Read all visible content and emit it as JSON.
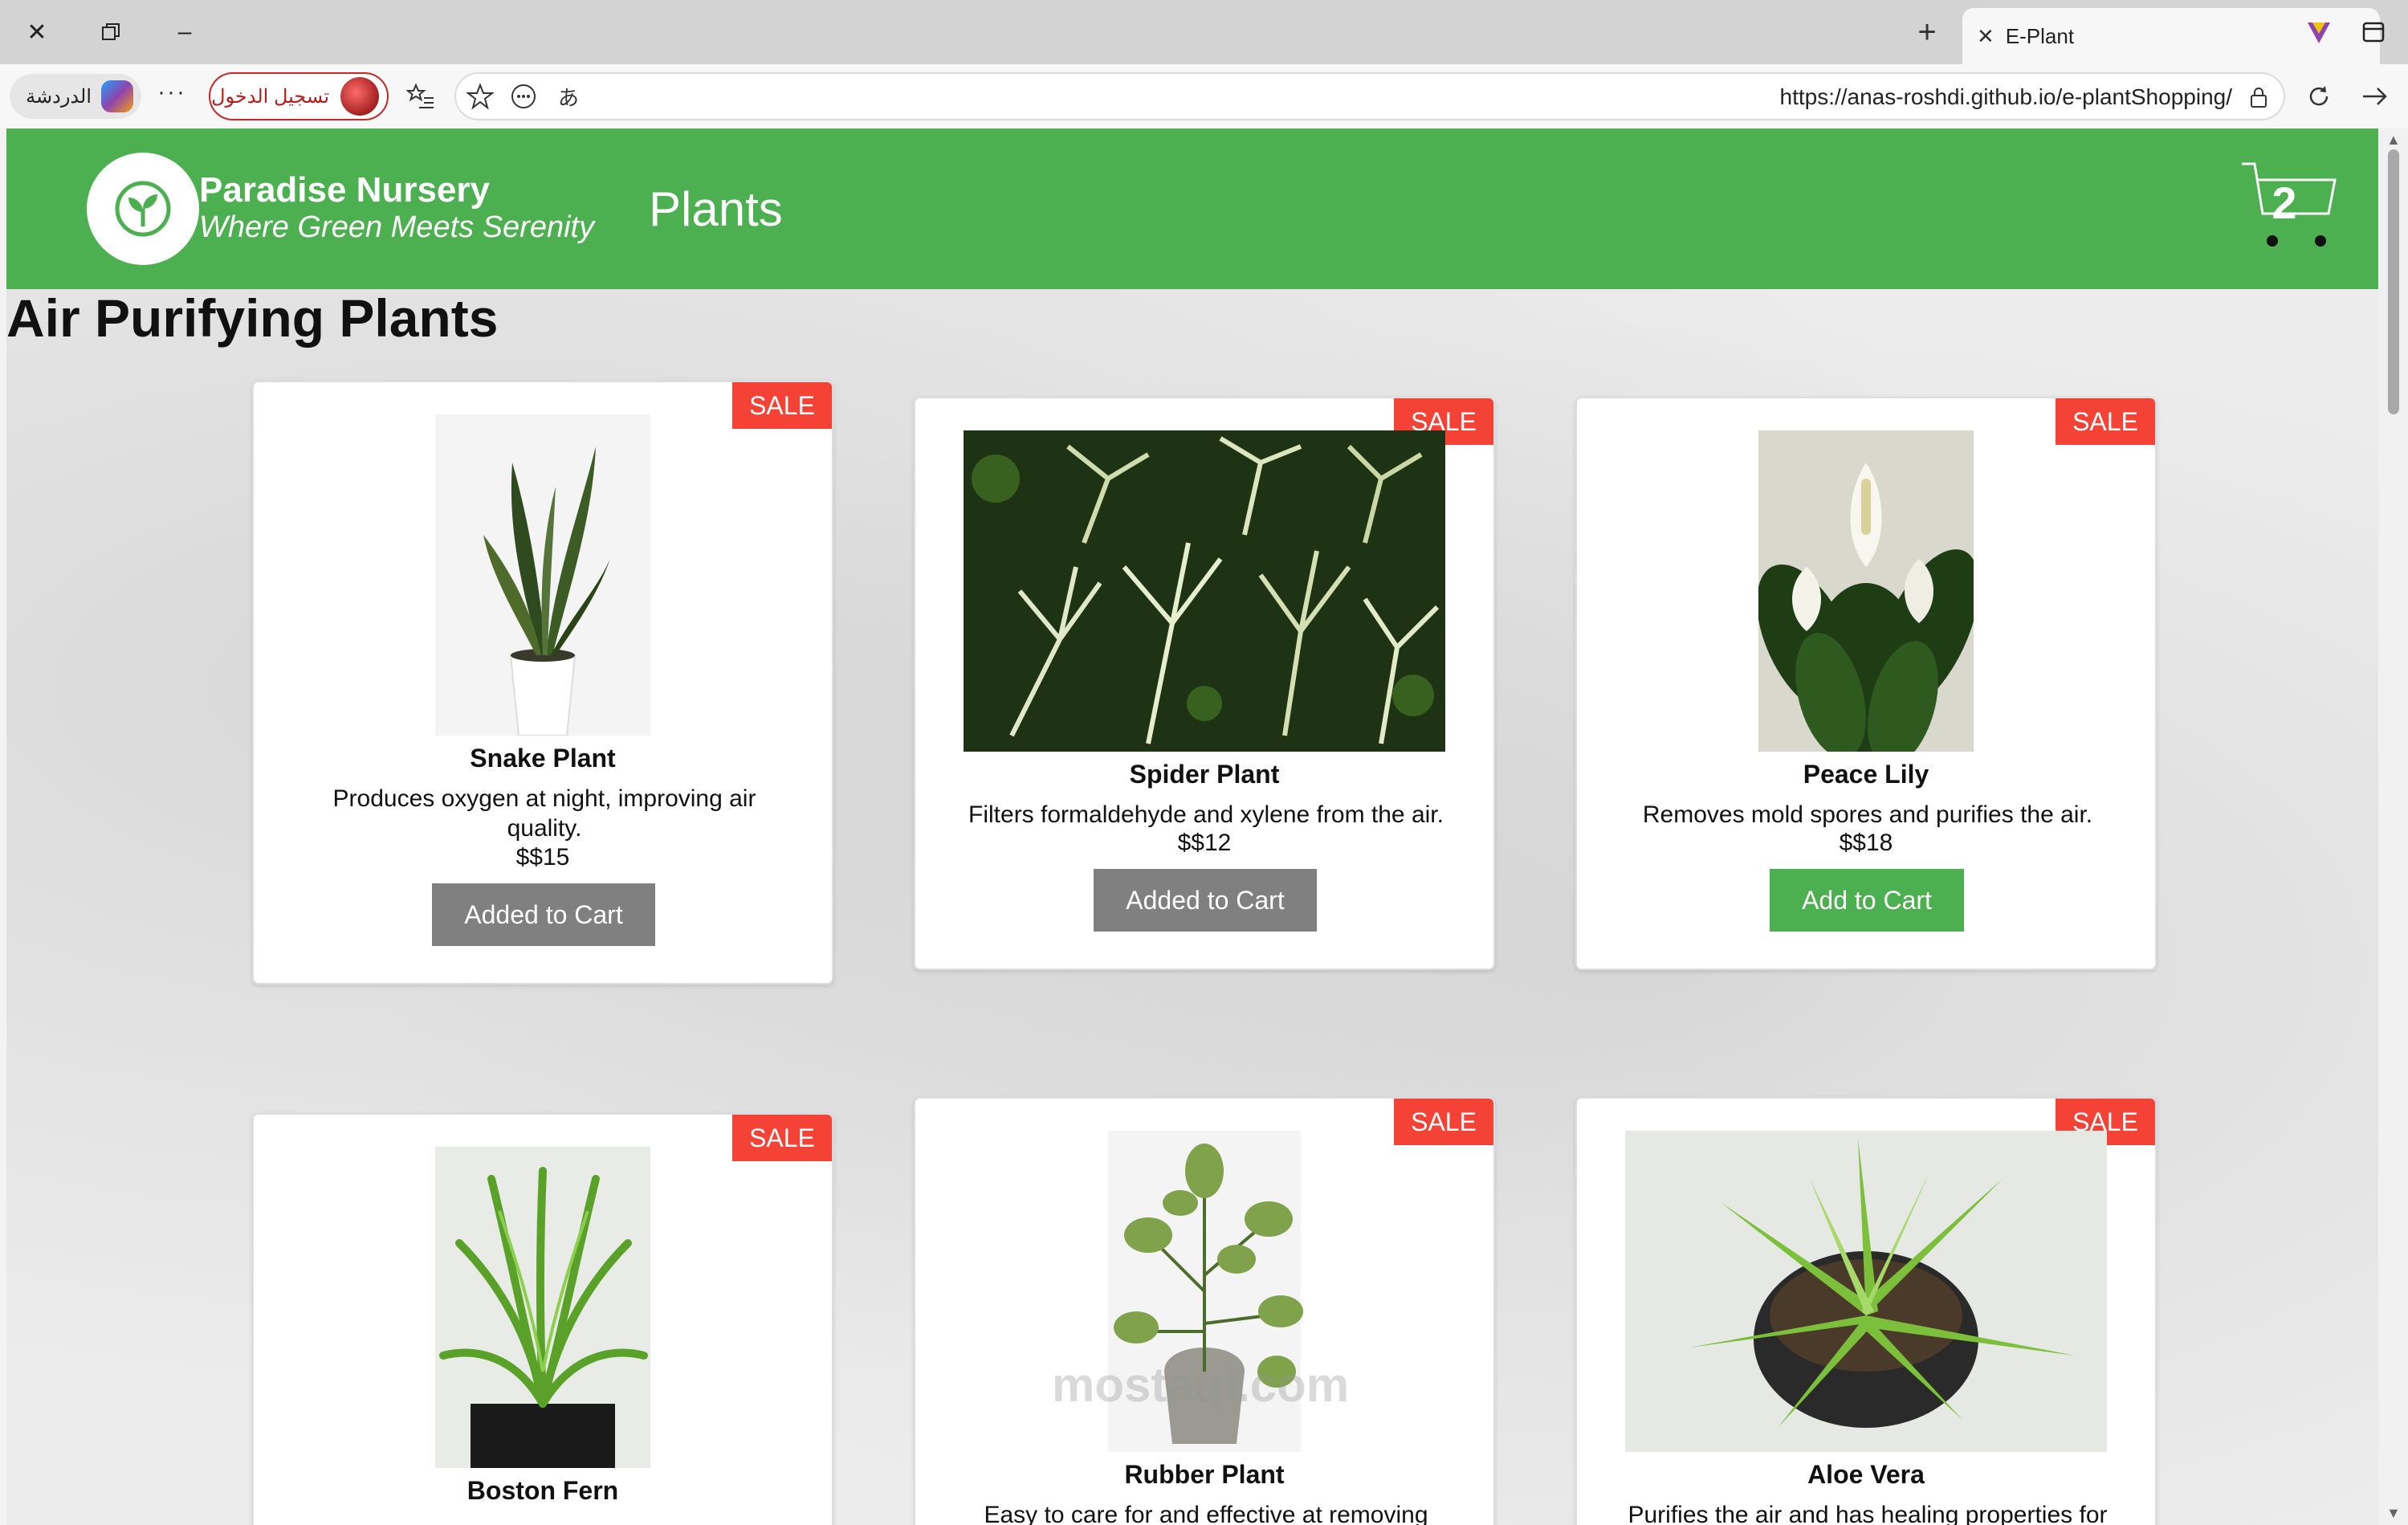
{
  "browser": {
    "tab_title": "E-Plant",
    "url": "https://anas-roshdi.github.io/e-plantShopping/",
    "chat_label": "الدردشة",
    "signin_label": "تسجيل الدخول",
    "more_label": "···"
  },
  "navbar": {
    "brand_name": "Paradise Nursery",
    "brand_tagline": "Where Green Meets Serenity",
    "plants_link": "Plants",
    "cart_count": "2",
    "accent_color": "#4caf50"
  },
  "section": {
    "title": "Air Purifying Plants"
  },
  "plants": [
    {
      "sale": "SALE",
      "name": "Snake Plant",
      "description": "Produces oxygen at night, improving air quality.",
      "price": "$$15",
      "button": "Added to Cart",
      "state": "added"
    },
    {
      "sale": "SALE",
      "name": "Spider Plant",
      "description": "Filters formaldehyde and xylene from the air.",
      "price": "$$12",
      "button": "Added to Cart",
      "state": "added"
    },
    {
      "sale": "SALE",
      "name": "Peace Lily",
      "description": "Removes mold spores and purifies the air.",
      "price": "$$18",
      "button": "Add to Cart",
      "state": "available"
    },
    {
      "sale": "SALE",
      "name": "Boston Fern"
    },
    {
      "sale": "SALE",
      "name": "Rubber Plant",
      "description": "Easy to care for and effective at removing"
    },
    {
      "sale": "SALE",
      "name": "Aloe Vera",
      "description": "Purifies the air and has healing properties for"
    }
  ],
  "watermark": "mostaql.com"
}
